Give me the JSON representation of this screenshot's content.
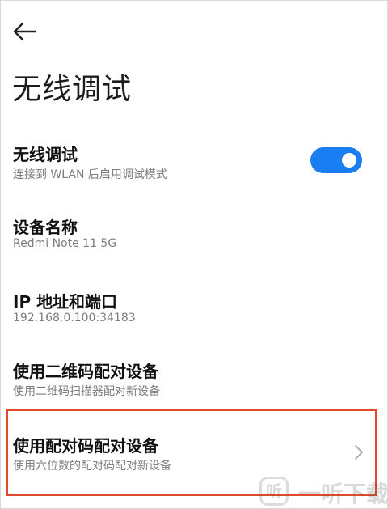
{
  "header": {
    "back_icon": "arrow-left-icon",
    "title": "无线调试"
  },
  "settings": {
    "wireless_debugging": {
      "title": "无线调试",
      "subtitle": "连接到 WLAN 后启用调试模式",
      "toggle_on": true,
      "toggle_color": "#1a7df1"
    },
    "device_name": {
      "title": "设备名称",
      "subtitle": "Redmi Note 11 5G"
    },
    "ip_port": {
      "title": "IP 地址和端口",
      "subtitle": "192.168.0.100:34183"
    },
    "qr_pairing": {
      "title": "使用二维码配对设备",
      "subtitle": "使用二维码扫描器配对新设备"
    },
    "code_pairing": {
      "title": "使用配对码配对设备",
      "subtitle": "使用六位数的配对码配对新设备",
      "chevron_icon": "chevron-right-icon",
      "highlight_color": "#e2492a"
    }
  },
  "watermark": {
    "logo_glyph": "听",
    "text": "一听下载"
  }
}
